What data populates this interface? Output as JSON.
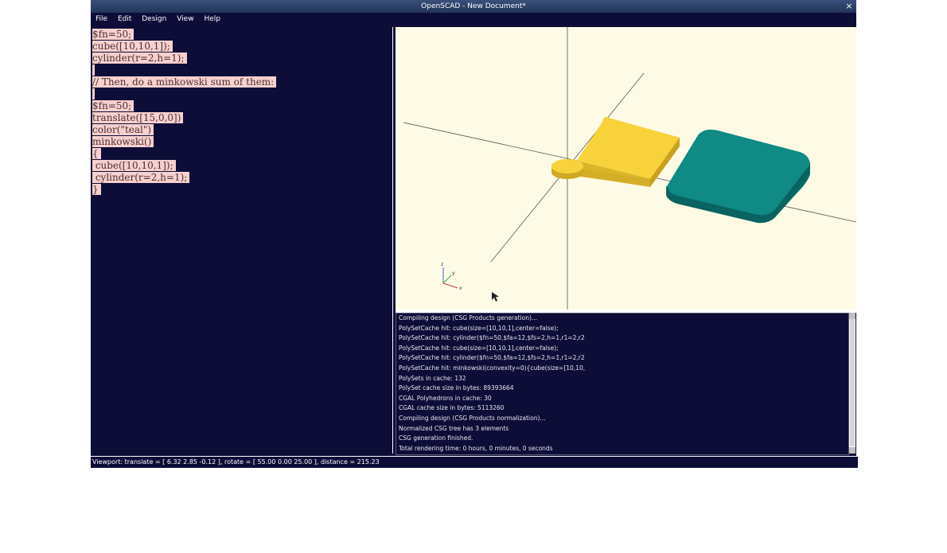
{
  "window": {
    "title": "OpenSCAD - New Document*",
    "close_glyph": "×"
  },
  "menu": {
    "items": [
      "File",
      "Edit",
      "Design",
      "View",
      "Help"
    ]
  },
  "editor": {
    "lines": [
      "$fn=50;",
      "cube([10,10,1]);",
      "cylinder(r=2,h=1);",
      "",
      "// Then, do a minkowski sum of them:",
      "",
      "$fn=50;",
      "translate([15,0,0])",
      "color(\"teal\")",
      "minkowski()",
      "{",
      " cube([10,10,1]);",
      " cylinder(r=2,h=1);",
      "}"
    ],
    "selection_color": "#f7d0cf"
  },
  "viewport": {
    "background": "#fdfbe6",
    "colors": {
      "yellow": "#f7d23a",
      "teal": "#0f8a85"
    },
    "axis_labels": {
      "x": "x",
      "y": "y",
      "z": "z"
    }
  },
  "console": {
    "messages": [
      "Compiling design (CSG Products generation)...",
      "PolySetCache hit: cube(size=[10,10,1],center=false);",
      "PolySetCache hit: cylinder($fn=50,$fa=12,$fs=2,h=1,r1=2,r2",
      "PolySetCache hit: cube(size=[10,10,1],center=false);",
      "PolySetCache hit: cylinder($fn=50,$fa=12,$fs=2,h=1,r1=2,r2",
      "PolySetCache hit: minkowski(convexity=0){cube(size=[10,10,",
      "PolySets in cache: 132",
      "PolySet cache size in bytes: 89393664",
      "CGAL Polyhedrons in cache: 30",
      "CGAL cache size in bytes: 5113260",
      "Compiling design (CSG Products normalization)...",
      "Normalized CSG tree has 3 elements",
      "CSG generation finished.",
      "Total rendering time: 0 hours, 0 minutes, 0 seconds"
    ]
  },
  "status": {
    "text": "Viewport: translate = [ 6.32 2.85 -0.12 ], rotate = [ 55.00 0.00 25.00 ], distance = 215.23"
  }
}
